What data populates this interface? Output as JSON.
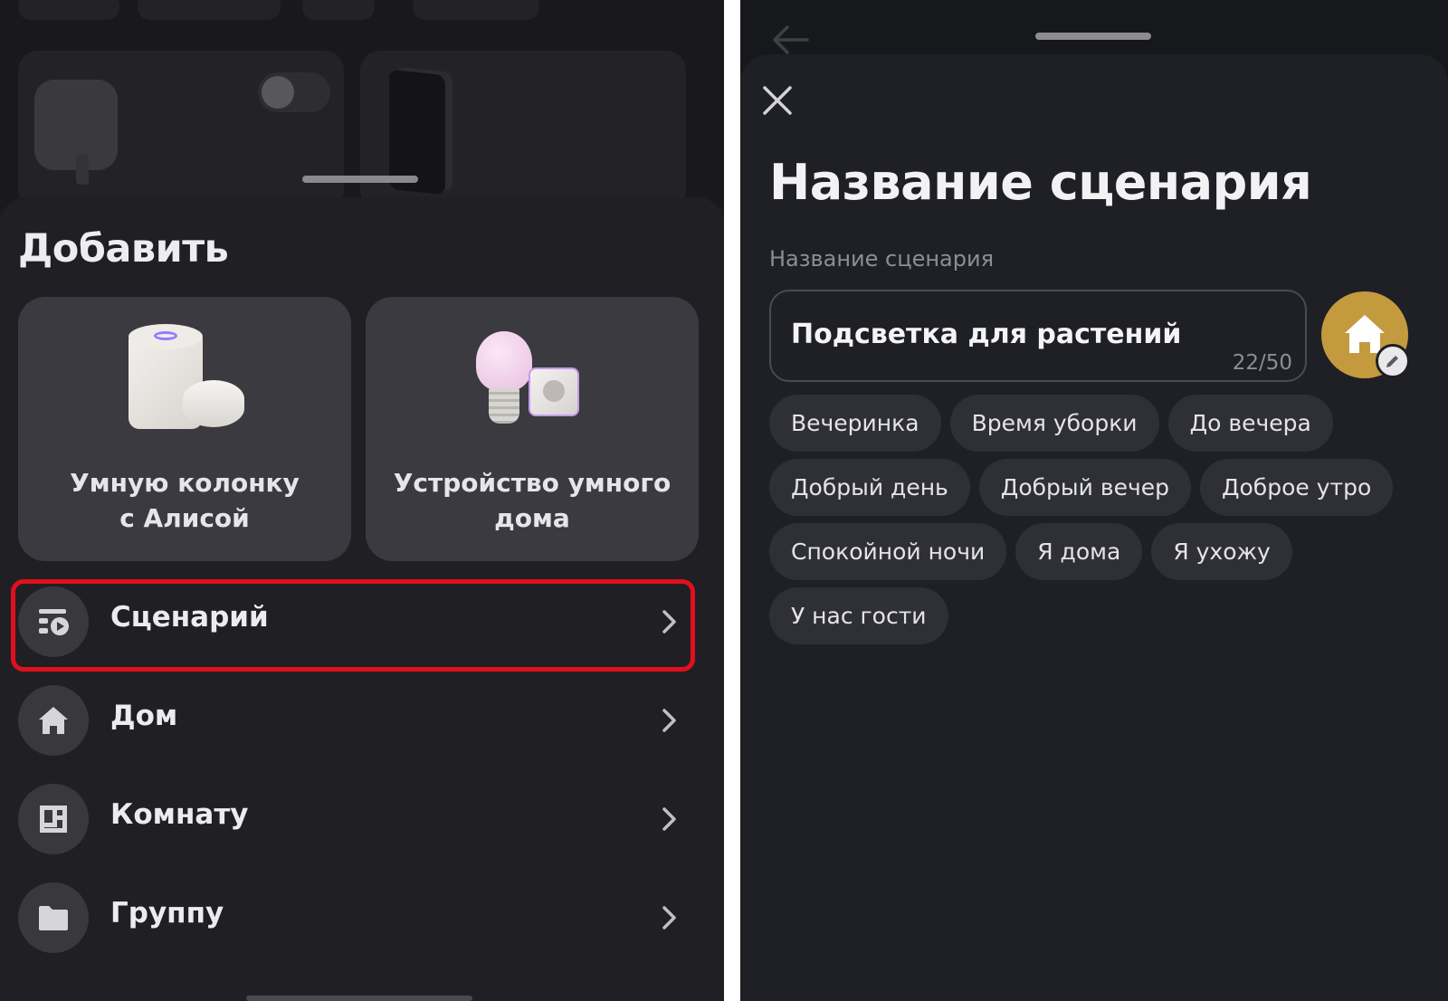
{
  "left": {
    "sheet_title": "Добавить",
    "cards": [
      {
        "label": "Умную колонку\nс Алисой"
      },
      {
        "label": "Устройство умного\nдома"
      }
    ],
    "menu": [
      {
        "label": "Сценарий",
        "icon": "scenario-icon",
        "highlighted": true
      },
      {
        "label": "Дом",
        "icon": "home-icon"
      },
      {
        "label": "Комнату",
        "icon": "room-icon"
      },
      {
        "label": "Группу",
        "icon": "folder-icon"
      }
    ],
    "highlight_color": "#e0101b"
  },
  "right": {
    "title": "Название сценария",
    "field_label": "Название сценария",
    "input_value": "Подсветка для растений",
    "char_count": "22/50",
    "avatar_color": "#c49a3f",
    "chips": [
      "Вечеринка",
      "Время уборки",
      "До вечера",
      "Добрый день",
      "Добрый вечер",
      "Доброе утро",
      "Спокойной ночи",
      "Я дома",
      "Я ухожу",
      "У нас гости"
    ]
  }
}
